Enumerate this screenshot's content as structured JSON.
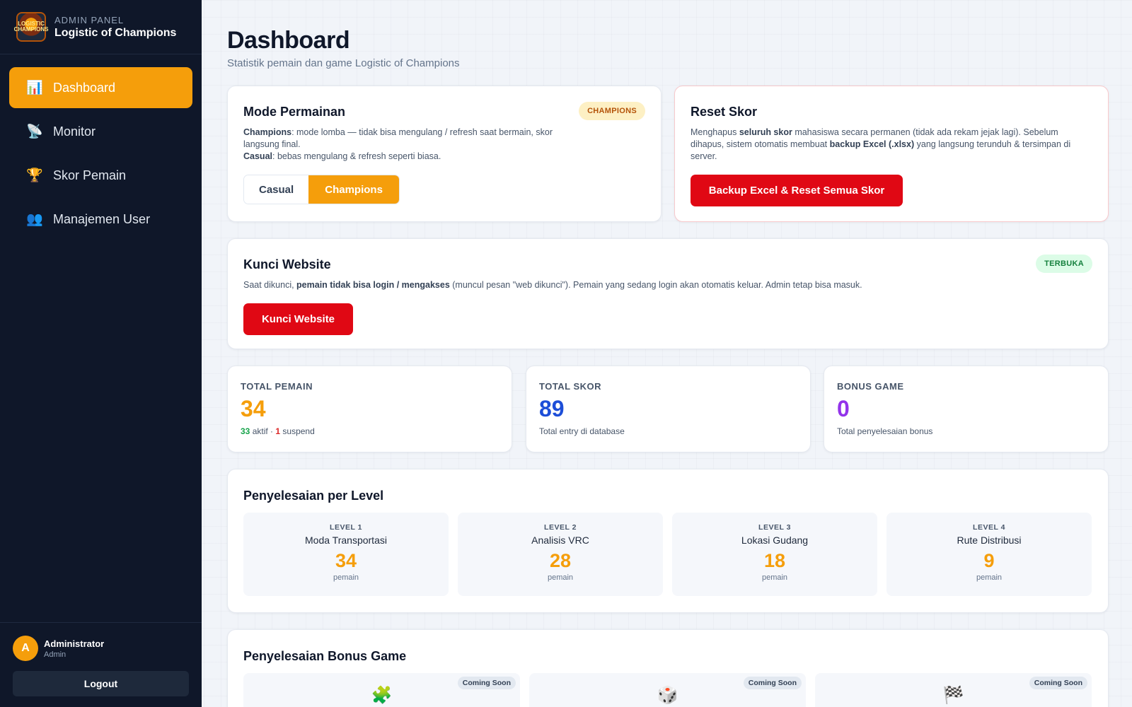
{
  "brand": {
    "sub": "ADMIN PANEL",
    "title": "Logistic of Champions",
    "logo_text": "LOGISTIC CHAMPIONS"
  },
  "nav": [
    {
      "label": "Dashboard",
      "icon": "📊"
    },
    {
      "label": "Monitor",
      "icon": "📡"
    },
    {
      "label": "Skor Pemain",
      "icon": "🏆"
    },
    {
      "label": "Manajemen User",
      "icon": "👥"
    }
  ],
  "user": {
    "initial": "A",
    "name": "Administrator",
    "role": "Admin",
    "logout": "Logout"
  },
  "page": {
    "title": "Dashboard",
    "subtitle": "Statistik pemain dan game Logistic of Champions"
  },
  "mode": {
    "title": "Mode Permainan",
    "badge": "CHAMPIONS",
    "line1_bold": "Champions",
    "line1_rest": ": mode lomba — tidak bisa mengulang / refresh saat bermain, skor langsung final.",
    "line2_bold": "Casual",
    "line2_rest": ": bebas mengulang & refresh seperti biasa.",
    "casual_label": "Casual",
    "champions_label": "Champions"
  },
  "reset": {
    "title": "Reset Skor",
    "t1": "Menghapus ",
    "b1": "seluruh skor",
    "t2": " mahasiswa secara permanen (tidak ada rekam jejak lagi). Sebelum dihapus, sistem otomatis membuat ",
    "b2": "backup Excel (.xlsx)",
    "t3": " yang langsung terunduh & tersimpan di server.",
    "button": "Backup Excel & Reset Semua Skor"
  },
  "lock": {
    "title": "Kunci Website",
    "badge": "TERBUKA",
    "t1": "Saat dikunci, ",
    "b1": "pemain tidak bisa login / mengakses",
    "t2": " (muncul pesan \"web dikunci\"). Pemain yang sedang login akan otomatis keluar. Admin tetap bisa masuk.",
    "button": "Kunci Website"
  },
  "stats": {
    "players": {
      "label": "TOTAL PEMAIN",
      "value": "34",
      "active": "33",
      "active_text": " aktif · ",
      "suspend": "1",
      "suspend_text": " suspend"
    },
    "score": {
      "label": "TOTAL SKOR",
      "value": "89",
      "sub": "Total entry di database"
    },
    "bonus": {
      "label": "BONUS GAME",
      "value": "0",
      "sub": "Total penyelesaian bonus"
    }
  },
  "levels": {
    "title": "Penyelesaian per Level",
    "items": [
      {
        "tag": "LEVEL 1",
        "name": "Moda Transportasi",
        "count": "34",
        "unit": "pemain"
      },
      {
        "tag": "LEVEL 2",
        "name": "Analisis VRC",
        "count": "28",
        "unit": "pemain"
      },
      {
        "tag": "LEVEL 3",
        "name": "Lokasi Gudang",
        "count": "18",
        "unit": "pemain"
      },
      {
        "tag": "LEVEL 4",
        "name": "Rute Distribusi",
        "count": "9",
        "unit": "pemain"
      }
    ]
  },
  "bonus_games": {
    "title": "Penyelesaian Bonus Game",
    "items": [
      {
        "icon": "🧩",
        "badge": "Coming Soon"
      },
      {
        "icon": "🎲",
        "badge": "Coming Soon"
      },
      {
        "icon": "🏁",
        "badge": "Coming Soon"
      }
    ]
  },
  "colors": {
    "accent": "#f59e0b",
    "danger": "#e00814",
    "score_blue": "#1d4ed8",
    "bonus_purple": "#9333ea",
    "active_green": "#16a34a",
    "suspend_red": "#dc2626"
  }
}
